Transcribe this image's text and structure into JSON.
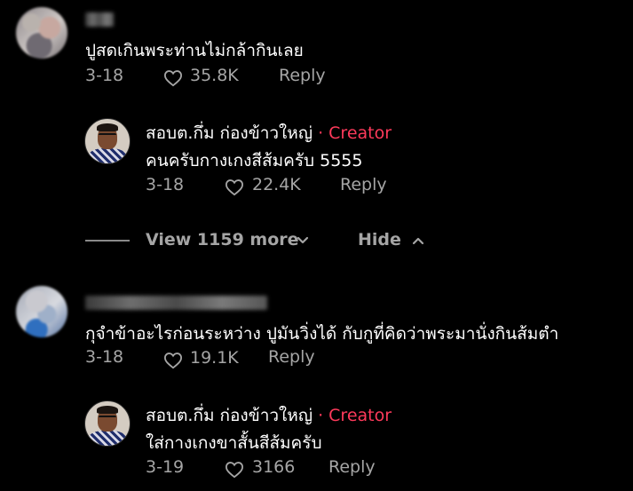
{
  "colors": {
    "background": "#000000",
    "text": "#ffffff",
    "meta": "#a5a5a5",
    "creator_tag": "#fe3a5b"
  },
  "comments": [
    {
      "text": "ปูสดเกินพระท่านไม่กล้ากินเลย",
      "date": "3-18",
      "likes": "35.8K",
      "reply_label": "Reply",
      "reply": {
        "author": "สอบต.กึ่ม ก่องข้าวใหญ่",
        "badge": "· Creator",
        "text": "คนครับกางเกงสีส้มครับ 5555",
        "date": "3-18",
        "likes": "22.4K",
        "reply_label": "Reply"
      }
    },
    {
      "text": "กุจำข้าอะไรก่อนระหว่าง ปูมันวิ่งได้ กับกูที่คิดว่าพระมานั่งกินส้มตำ",
      "date": "3-18",
      "likes": "19.1K",
      "reply_label": "Reply",
      "reply": {
        "author": "สอบต.กึ่ม ก่องข้าวใหญ่",
        "badge": "· Creator",
        "text": "ใส่กางเกงขาสั้นสีส้มครับ",
        "date": "3-19",
        "likes": "3166",
        "reply_label": "Reply"
      }
    }
  ],
  "thread_controls": {
    "view_more": "View 1159 more",
    "hide": "Hide"
  },
  "icons": {
    "like": "heart-outline-icon",
    "expand": "chevron-down-icon",
    "collapse": "chevron-up-icon"
  }
}
